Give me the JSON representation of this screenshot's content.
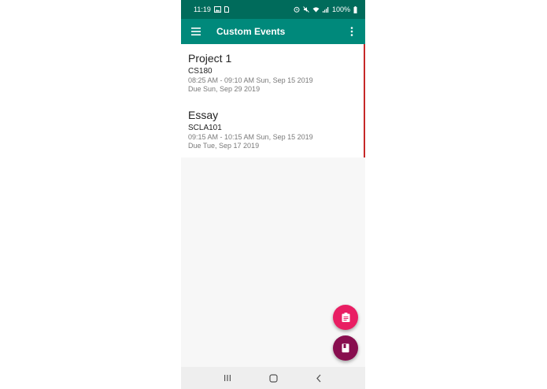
{
  "status_bar": {
    "time": "11:19",
    "battery": "100%",
    "icons": [
      "image-icon",
      "sim-icon",
      "alarm-icon",
      "mute-icon",
      "wifi-icon",
      "signal-icon",
      "battery-icon"
    ]
  },
  "toolbar": {
    "title": "Custom Events",
    "menu_icon": "hamburger-menu-icon",
    "overflow_icon": "more-vert-icon"
  },
  "events": [
    {
      "name": "Project 1",
      "course": "CS180",
      "time": "08:25 AM - 09:10 AM Sun, Sep 15 2019",
      "due": "Due Sun, Sep 29 2019"
    },
    {
      "name": "Essay",
      "course": "SCLA101",
      "time": "09:15 AM - 10:15 AM Sun, Sep 15 2019",
      "due": "Due Tue, Sep 17 2019"
    }
  ],
  "fabs": [
    {
      "icon": "assignment-icon",
      "color": "#e91e63"
    },
    {
      "icon": "class-book-icon",
      "color": "#880e4f"
    }
  ],
  "nav_bar": {
    "icons": [
      "recents-icon",
      "home-icon",
      "back-icon"
    ]
  },
  "colors": {
    "status_bar": "#006b5b",
    "toolbar": "#00897b",
    "accent_stripe": "#c62828"
  }
}
